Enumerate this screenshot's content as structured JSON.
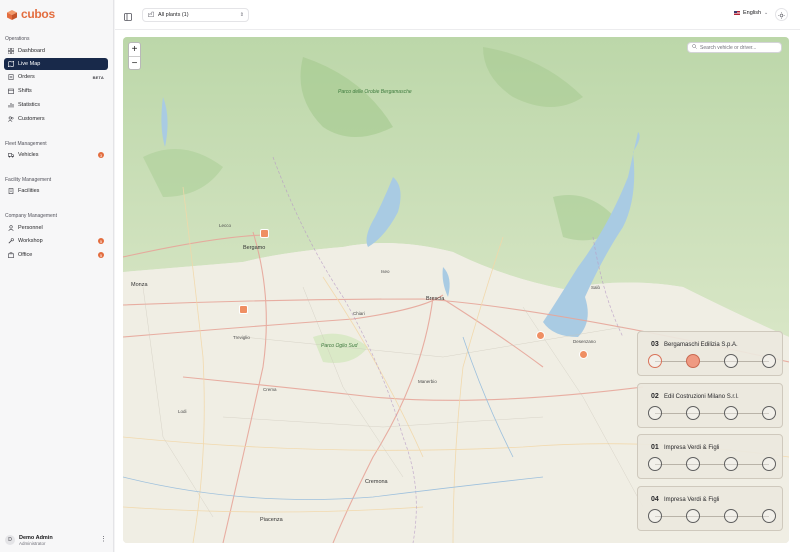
{
  "brand": {
    "name": "cubos",
    "color": "#e36d3f"
  },
  "sidebar": {
    "sections": {
      "operations": "Operations",
      "fleet": "Fleet Management",
      "facility": "Facility Management",
      "company": "Company Management"
    },
    "items": [
      {
        "label": "Dashboard",
        "icon": "grid-icon"
      },
      {
        "label": "Live Map",
        "icon": "map-icon",
        "active": true
      },
      {
        "label": "Orders",
        "icon": "clipboard-icon",
        "badge": "BETA"
      },
      {
        "label": "Shifts",
        "icon": "calendar-icon"
      },
      {
        "label": "Statistics",
        "icon": "chart-icon"
      },
      {
        "label": "Customers",
        "icon": "users-icon"
      },
      {
        "label": "Vehicles",
        "icon": "truck-icon",
        "count": "3"
      },
      {
        "label": "Facilities",
        "icon": "building-icon"
      },
      {
        "label": "Personnel",
        "icon": "user-icon"
      },
      {
        "label": "Workshop",
        "icon": "wrench-icon",
        "count": "5"
      },
      {
        "label": "Office",
        "icon": "briefcase-icon",
        "count": "5"
      }
    ],
    "user": {
      "initial": "D",
      "name": "Demo Admin",
      "role": "Administrator"
    }
  },
  "topbar": {
    "plant_filter": "All plants (1)",
    "language": "English"
  },
  "map": {
    "search_placeholder": "Search vehicle or driver...",
    "zoom_in": "+",
    "zoom_out": "−",
    "places": {
      "monza": "Monza",
      "brescia": "Brescia",
      "cremona": "Cremona",
      "piacenza": "Piacenza",
      "parco_orobie": "Parco delle Orobie Bergamasche",
      "parco_oglio": "Parco Oglio Sud",
      "salo": "Salò",
      "desenzano": "Desenzano",
      "lecco": "Lecco",
      "bergamo": "Bergamo",
      "treviglio": "Treviglio",
      "lodi": "Lodi",
      "crema": "Crema",
      "chiari": "Chiari",
      "manerbio": "Manerbio",
      "iseo": "Iseo"
    }
  },
  "orders": [
    {
      "number": "03",
      "customer": "Bergamaschi Edilizia S.p.A.",
      "progress": 2,
      "steps": 4
    },
    {
      "number": "02",
      "customer": "Edil Costruzioni Milano S.r.l.",
      "progress": 0,
      "steps": 4
    },
    {
      "number": "01",
      "customer": "Impresa Verdi & Figli",
      "progress": 0,
      "steps": 4
    },
    {
      "number": "04",
      "customer": "Impresa Verdi & Figli",
      "progress": 0,
      "steps": 4
    }
  ]
}
